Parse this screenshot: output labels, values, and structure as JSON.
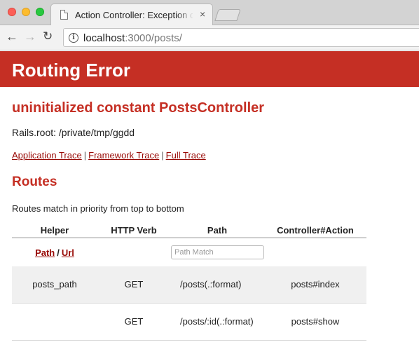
{
  "browser": {
    "tab_title": "Action Controller: Exception caught",
    "tab_close": "×",
    "url_host": "localhost",
    "url_rest": ":3000/posts/",
    "back": "←",
    "forward": "→",
    "reload": "↻",
    "info": "i"
  },
  "page": {
    "header_title": "Routing Error",
    "error_message": "uninitialized constant PostsController",
    "rails_root": "Rails.root: /private/tmp/ggdd",
    "traces": [
      "Application Trace",
      "Framework Trace",
      "Full Trace"
    ],
    "trace_separator": "|",
    "routes_heading": "Routes",
    "routes_description": "Routes match in priority from top to bottom"
  },
  "routes_table": {
    "headers": [
      "Helper",
      "HTTP Verb",
      "Path",
      "Controller#Action"
    ],
    "filter": {
      "path_link": "Path",
      "slash": "/",
      "url_link": "Url",
      "placeholder": "Path Match"
    },
    "rows": [
      {
        "helper": "posts_path",
        "verb": "GET",
        "path": "/posts(.:format)",
        "action": "posts#index"
      },
      {
        "helper": "",
        "verb": "GET",
        "path": "/posts/:id(.:format)",
        "action": "posts#show"
      }
    ]
  },
  "colors": {
    "header_bg": "#c52f24",
    "heading_text": "#c52f24",
    "link": "#980905",
    "odd_row_bg": "#f0f0f0"
  }
}
